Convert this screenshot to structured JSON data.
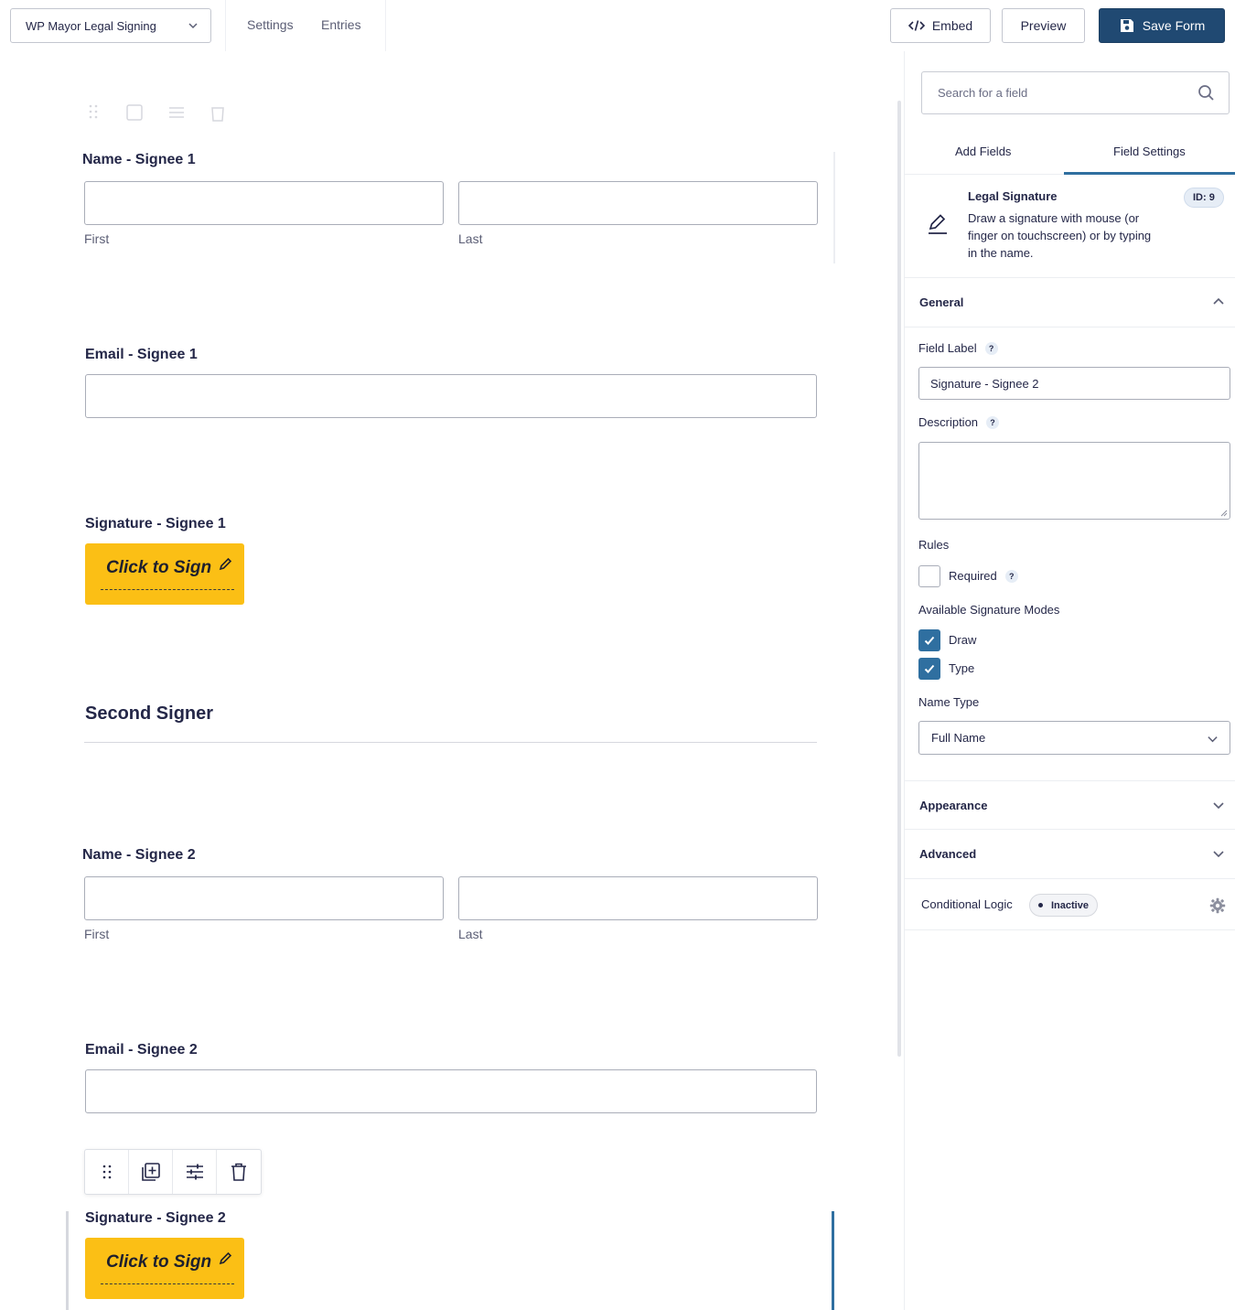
{
  "topbar": {
    "form_name": "WP Mayor Legal Signing",
    "nav": [
      "Settings",
      "Entries"
    ],
    "embed_label": "Embed",
    "preview_label": "Preview",
    "save_label": "Save Form"
  },
  "form": {
    "name_signee1": {
      "label": "Name - Signee 1",
      "first": "First",
      "last": "Last"
    },
    "email_signee1": {
      "label": "Email - Signee 1"
    },
    "signature_signee1": {
      "label": "Signature - Signee 1",
      "button": "Click to Sign"
    },
    "section_title": "Second Signer",
    "name_signee2": {
      "label": "Name - Signee 2",
      "first": "First",
      "last": "Last"
    },
    "email_signee2": {
      "label": "Email - Signee 2"
    },
    "signature_signee2": {
      "label": "Signature - Signee 2",
      "button": "Click to Sign"
    }
  },
  "sidebar": {
    "search_placeholder": "Search for a field",
    "tabs": [
      "Add Fields",
      "Field Settings"
    ],
    "active_tab": "Field Settings",
    "field_info": {
      "title": "Legal Signature",
      "description": "Draw a signature with mouse (or finger on touchscreen) or by typing in the name.",
      "id_badge": "ID: 9"
    },
    "general": {
      "heading": "General",
      "field_label_title": "Field Label",
      "field_label_value": "Signature - Signee 2",
      "description_title": "Description",
      "rules_title": "Rules",
      "required_label": "Required",
      "required_checked": false,
      "modes_title": "Available Signature Modes",
      "modes": [
        {
          "label": "Draw",
          "checked": true
        },
        {
          "label": "Type",
          "checked": true
        }
      ],
      "name_type_title": "Name Type",
      "name_type_value": "Full Name",
      "help_mark": "?"
    },
    "appearance": "Appearance",
    "advanced": "Advanced",
    "conditional_logic": {
      "label": "Conditional Logic",
      "status": "Inactive"
    }
  },
  "colors": {
    "primary": "#204972",
    "accent": "#2f6fa0",
    "sign_button": "#fbbf15",
    "text": "#242748"
  }
}
